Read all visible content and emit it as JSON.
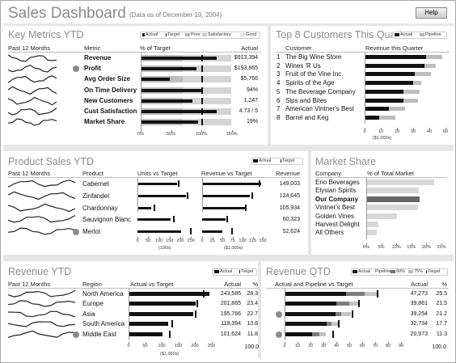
{
  "header": {
    "title": "Sales Dashboard",
    "asof": "(Data as of December 19, 2004)",
    "help": "Help"
  },
  "km": {
    "title": "Key Metrics YTD",
    "legend": [
      "Actual",
      "Target",
      "Poor",
      "Satisfactory",
      "Good"
    ],
    "cols": {
      "spark": "Past 12 Months",
      "metric": "Metric",
      "pct": "% of Target",
      "actual": "Actual"
    },
    "ticks": [
      "0%",
      "50%",
      "100%",
      "150%"
    ],
    "rows": [
      {
        "metric": "Revenue",
        "actual": "$913,394",
        "pct": 125,
        "target": 100,
        "flag": false
      },
      {
        "metric": "Profit",
        "actual": "$193,865",
        "pct": 92,
        "target": 100,
        "flag": true
      },
      {
        "metric": "Avg Order Size",
        "actual": "$5,766",
        "pct": 48,
        "target": 100,
        "flag": false
      },
      {
        "metric": "On Time Delivery",
        "actual": "94%",
        "pct": 102,
        "target": 100,
        "flag": false
      },
      {
        "metric": "New Customers",
        "actual": "1,247",
        "pct": 85,
        "target": 100,
        "flag": false
      },
      {
        "metric": "Cust Satisfaction",
        "actual": "4.73 / 5",
        "pct": 125,
        "target": 100,
        "flag": false
      },
      {
        "metric": "Market Share",
        "actual": "19%",
        "pct": 95,
        "target": 100,
        "flag": false
      }
    ]
  },
  "top": {
    "title": "Top 8 Customers This Quarter",
    "legend": [
      "Actual",
      "Pipeline"
    ],
    "cols": {
      "customer": "Customer",
      "rev": "Revenue this Quarter"
    },
    "ticks": [
      "0",
      "10",
      "20",
      "30",
      "40",
      "50"
    ],
    "unit": "($1,000s)",
    "rows": [
      {
        "num": "1",
        "name": "The Big Wine Store",
        "actual": 38,
        "pipeline": 48
      },
      {
        "num": "2",
        "name": "Wines 'R Us",
        "actual": 37,
        "pipeline": 44
      },
      {
        "num": "3",
        "name": "Fruit of the Vine Inc.",
        "actual": 31,
        "pipeline": 41
      },
      {
        "num": "4",
        "name": "Spirits of the Age",
        "actual": 30,
        "pipeline": 35
      },
      {
        "num": "5",
        "name": "The Beverage Company",
        "actual": 24,
        "pipeline": 34
      },
      {
        "num": "6",
        "name": "Sips and Bites",
        "actual": 24,
        "pipeline": 33
      },
      {
        "num": "7",
        "name": "American Vintner's Best",
        "actual": 15,
        "pipeline": 25
      },
      {
        "num": "8",
        "name": "Barrel and Keg",
        "actual": 9,
        "pipeline": 19
      }
    ]
  },
  "ps": {
    "title": "Product Sales YTD",
    "legend": [
      "Actual",
      "Target"
    ],
    "cols": {
      "spark": "Past 12 Months",
      "product": "Product",
      "units": "Units vs Target",
      "rvt": "Revenue vs Target",
      "rev": "Revenue"
    },
    "uticks": [
      "0",
      "50",
      "100",
      "150",
      "200",
      "250"
    ],
    "uunit": "(100s)",
    "rticks": [
      "0",
      "25",
      "50",
      "75",
      "100",
      "125",
      "150"
    ],
    "runit": "($1,000s)",
    "rows": [
      {
        "product": "Cabernet",
        "units": 185,
        "utarget": 190,
        "revbar": 145,
        "rtarget": 140,
        "rev": "149,003",
        "flag": false
      },
      {
        "product": "Zinfandel",
        "units": 225,
        "utarget": 230,
        "revbar": 118,
        "rtarget": 122,
        "rev": "124,645",
        "flag": false
      },
      {
        "product": "Chardonnay",
        "units": 65,
        "utarget": 75,
        "revbar": 108,
        "rtarget": 105,
        "rev": "105,934",
        "flag": false
      },
      {
        "product": "Sauvignon Blanc",
        "units": 155,
        "utarget": 165,
        "revbar": 58,
        "rtarget": 60,
        "rev": "60,323",
        "flag": false
      },
      {
        "product": "Merlot",
        "units": 205,
        "utarget": 245,
        "revbar": 50,
        "rtarget": 72,
        "rev": "52,624",
        "flag": true
      }
    ]
  },
  "ms": {
    "title": "Market Share",
    "cols": {
      "company": "Company",
      "share": "% of Total Market"
    },
    "ticks": [
      "0%",
      "5%",
      "10%",
      "15%",
      "20%",
      "25%"
    ],
    "rows": [
      {
        "company": "Eno Beverages",
        "share": 22.5,
        "ours": false
      },
      {
        "company": "Elysian Spirits",
        "share": 17.5,
        "ours": false
      },
      {
        "company": "Our Company",
        "share": 17.8,
        "ours": true
      },
      {
        "company": "Vintner's Best",
        "share": 17.2,
        "ours": false
      },
      {
        "company": "Golden Vines",
        "share": 10.3,
        "ours": false
      },
      {
        "company": "Harvest Delight",
        "share": 4.0,
        "ours": false
      },
      {
        "company": "All Others",
        "share": 3.5,
        "ours": false
      }
    ]
  },
  "ry": {
    "title": "Revenue YTD",
    "legend": [
      "Actual",
      "Target"
    ],
    "cols": {
      "spark": "Past 12 Months",
      "region": "Region",
      "avt": "Actual vs Target",
      "actual": "Actual",
      "pct": "%"
    },
    "ticks": [
      "0",
      "50",
      "100",
      "150",
      "200",
      "250"
    ],
    "unit": "($1,000s)",
    "total": "100.0",
    "rows": [
      {
        "region": "North America",
        "actual": "243,585",
        "pct": "28.3",
        "bar": 243.6,
        "target": 225,
        "flag": false
      },
      {
        "region": "Europe",
        "actual": "201,865",
        "pct": "23.4",
        "bar": 201.9,
        "target": 205,
        "flag": false
      },
      {
        "region": "Asia",
        "actual": "195,766",
        "pct": "22.7",
        "bar": 195.8,
        "target": 200,
        "flag": false
      },
      {
        "region": "South America",
        "actual": "119,394",
        "pct": "13.8",
        "bar": 119.4,
        "target": 130,
        "flag": false
      },
      {
        "region": "Middle East",
        "actual": "101,624",
        "pct": "11.8",
        "bar": 101.6,
        "target": 122,
        "flag": true
      }
    ]
  },
  "rq": {
    "title": "Revenue QTD",
    "legend": [
      "Actual",
      "Pipeline:",
      "90%",
      "75%",
      "Target"
    ],
    "cols": {
      "apt": "Actual and Pipeline vs Target",
      "actual": "Actual",
      "pct": "%"
    },
    "ticks": [
      "0",
      "10",
      "20",
      "30",
      "40",
      "50",
      "60",
      "70",
      "80",
      "90"
    ],
    "total": "100.0",
    "rows": [
      {
        "actual": "47,273",
        "pct": "25.5",
        "bar": 47.3,
        "p90": 62,
        "p75": 72,
        "target": 71,
        "flag": false
      },
      {
        "actual": "39,861",
        "pct": "21.5",
        "bar": 39.9,
        "p90": 50,
        "p75": 58,
        "target": 57,
        "flag": false
      },
      {
        "actual": "39,254",
        "pct": "21.2",
        "bar": 39.3,
        "p90": 44,
        "p75": 51,
        "target": 52,
        "flag": true
      },
      {
        "actual": "32,734",
        "pct": "17.7",
        "bar": 32.7,
        "p90": 36,
        "p75": 42,
        "target": 41,
        "flag": false
      },
      {
        "actual": "20,973",
        "pct": "11.3",
        "bar": 21.0,
        "p90": 27,
        "p75": 32,
        "target": 37,
        "flag": true
      }
    ]
  }
}
